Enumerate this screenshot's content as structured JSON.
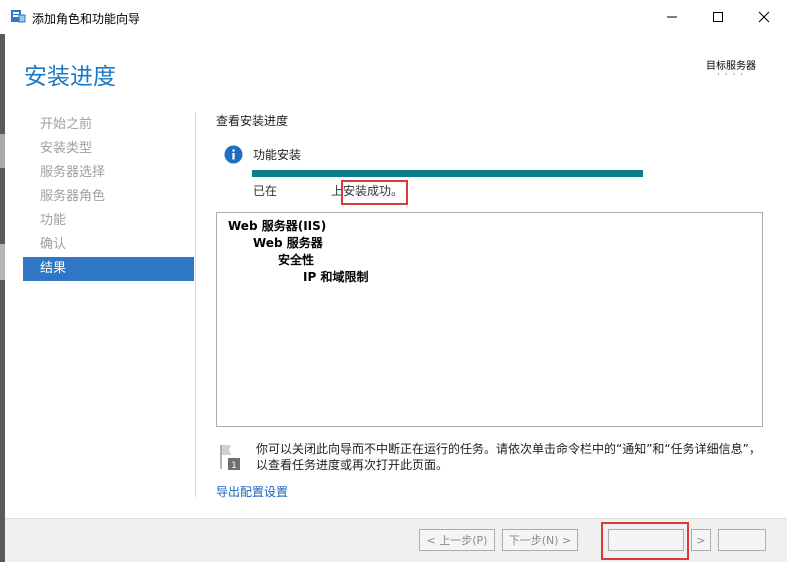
{
  "window": {
    "title": "添加角色和功能向导",
    "icon": "server-manager-icon",
    "controls": [
      "minimize-icon",
      "maximize-icon",
      "close-icon"
    ]
  },
  "header": {
    "page_title": "安装进度",
    "target_label": "目标服务器",
    "target_value": "· · · ·"
  },
  "nav": {
    "items": [
      {
        "label": "开始之前",
        "active": false
      },
      {
        "label": "安装类型",
        "active": false
      },
      {
        "label": "服务器选择",
        "active": false
      },
      {
        "label": "服务器角色",
        "active": false
      },
      {
        "label": "功能",
        "active": false
      },
      {
        "label": "确认",
        "active": false
      },
      {
        "label": "结果",
        "active": true
      }
    ]
  },
  "main": {
    "section_label": "查看安装进度",
    "status_title": "功能安装",
    "progress": 1.0,
    "status_prefix": "已在",
    "status_suffix": "上安装成功。",
    "tree": [
      "Web 服务器(IIS)",
      "Web 服务器",
      "安全性",
      "IP 和域限制"
    ],
    "note": "你可以关闭此向导而不中断正在运行的任务。请依次单击命令栏中的“通知”和“任务详细信息”，以查看任务进度或再次打开此页面。",
    "export_link": "导出配置设置"
  },
  "footer": {
    "prev_label": "< 上一步(P)",
    "next_label": "下一步(N) >",
    "close_label": "",
    "install_label": "> ",
    "cancel_label": ""
  },
  "colors": {
    "accent": "#1979ca",
    "nav_active": "#2f77c4",
    "progress": "#0d7c8e",
    "highlight": "#d93a3a",
    "link": "#1c63b7"
  }
}
